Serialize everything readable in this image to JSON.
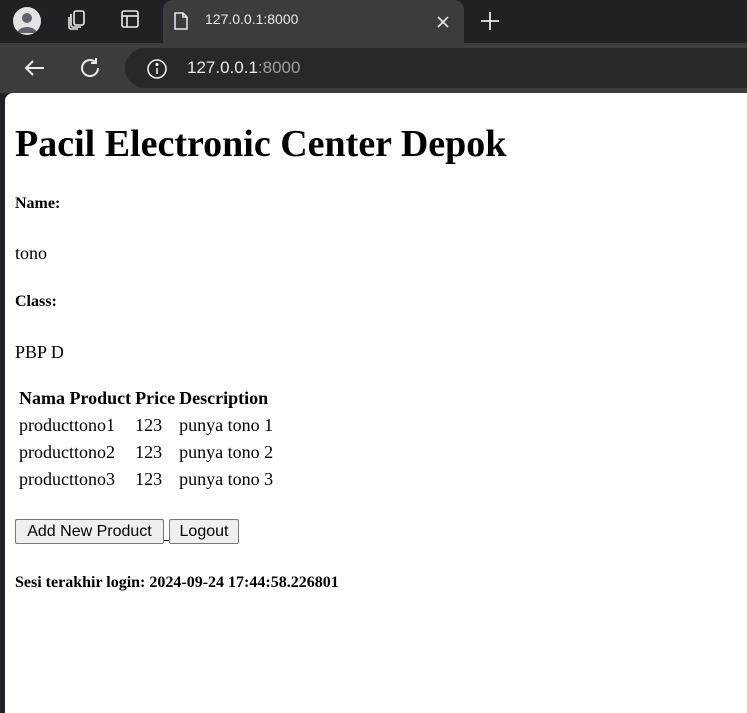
{
  "browser": {
    "tab_title": "127.0.0.1:8000",
    "url_host": "127.0.0.1",
    "url_port": ":8000",
    "icons": {
      "profile": "profile-avatar-icon",
      "tab_search": "collections-icon",
      "tab_groups": "sidebar-panel-icon",
      "page": "page-icon",
      "close": "close-icon",
      "new_tab": "plus-icon",
      "back": "back-arrow-icon",
      "reload": "reload-icon",
      "site_info": "info-icon"
    }
  },
  "page": {
    "title": "Pacil Electronic Center Depok",
    "name_label": "Name:",
    "name_value": "tono",
    "class_label": "Class:",
    "class_value": "PBP D",
    "table": {
      "headers": [
        "Nama Product",
        "Price",
        "Description"
      ],
      "rows": [
        [
          "producttono1",
          "123",
          "punya tono 1"
        ],
        [
          "producttono2",
          "123",
          "punya tono 2"
        ],
        [
          "producttono3",
          "123",
          "punya tono 3"
        ]
      ]
    },
    "add_button": "Add New Product",
    "logout_button": "Logout",
    "last_login": "Sesi terakhir login: 2024-09-24 17:44:58.226801"
  }
}
